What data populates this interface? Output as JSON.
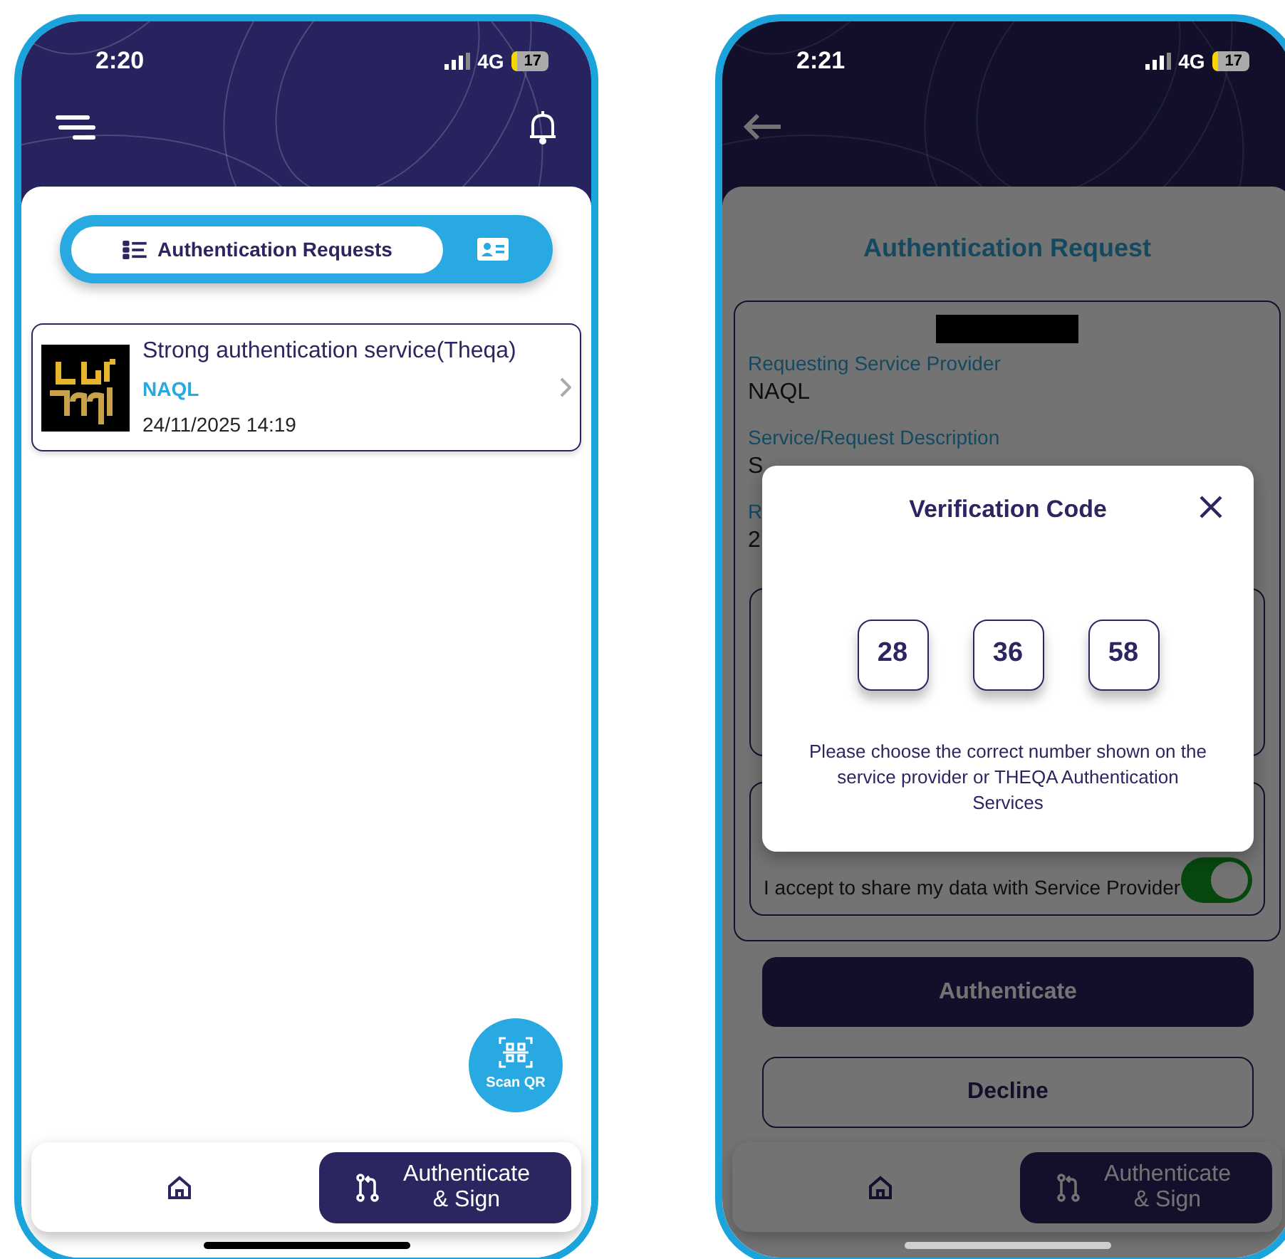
{
  "request_list_screen": {
    "status_bar": {
      "time": "2:20",
      "network": "4G",
      "battery": "17"
    },
    "tabs": [
      {
        "label": "Authentication Requests",
        "kind": "list",
        "selected": true
      },
      {
        "kind": "card",
        "selected": false
      }
    ],
    "requests": [
      {
        "title": "Strong authentication service(Theqa)",
        "provider": "NAQL",
        "date": "24/11/2025 14:19"
      }
    ],
    "scan_button": {
      "label": "Scan QR"
    },
    "bottom_nav": [
      {
        "kind": "home",
        "selected": false
      },
      {
        "kind": "sign",
        "label": "Authenticate & Sign",
        "selected": true
      }
    ]
  },
  "request_detail_screen": {
    "status_bar": {
      "time": "2:21",
      "network": "4G",
      "battery": "17"
    },
    "title": "Authentication Request",
    "fields": [
      {
        "label": "Requesting Service Provider",
        "value": "NAQL"
      },
      {
        "label": "Service/Request Description",
        "value": "S"
      },
      {
        "label": "R",
        "value": "2"
      }
    ],
    "consent": {
      "label": "I accept to share my data with Service Provider",
      "on": true
    },
    "buttons": [
      {
        "label": "Authenticate",
        "kind": "primary"
      },
      {
        "label": "Decline",
        "kind": "secondary"
      }
    ],
    "bottom_nav": [
      {
        "kind": "home",
        "selected": false
      },
      {
        "kind": "sign",
        "label": "Authenticate & Sign",
        "selected": true
      }
    ],
    "modal": {
      "title": "Verification Code",
      "codes": [
        "28",
        "36",
        "58"
      ],
      "message": "Please choose the correct number shown on the service provider or THEQA Authentication Services"
    }
  }
}
